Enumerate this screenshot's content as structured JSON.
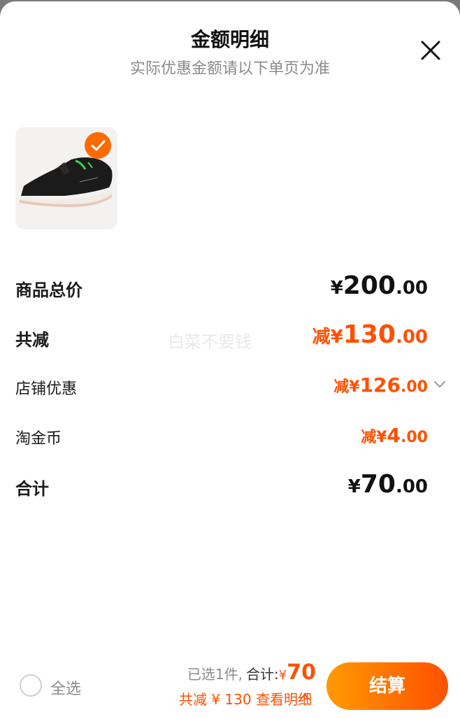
{
  "header": {
    "title": "金额明细",
    "subtitle": "实际优惠金额请以下单页为准",
    "close_icon": "close-icon"
  },
  "product": {
    "image_icon": "running-shoe-image",
    "selected": true
  },
  "summary": {
    "total_price": {
      "label": "商品总价",
      "symbol": "¥",
      "int": "200",
      "dec": ".00"
    },
    "total_discount": {
      "label": "共减",
      "prefix": "减",
      "symbol": "¥",
      "int": "130",
      "dec": ".00"
    },
    "shop_discount": {
      "label": "店铺优惠",
      "prefix": "减",
      "symbol": "¥",
      "int": "126",
      "dec": ".00",
      "icon": "chevron-down-icon"
    },
    "taojinbi": {
      "label": "淘金币",
      "prefix": "减",
      "symbol": "¥",
      "int": "4",
      "dec": ".00"
    },
    "total": {
      "label": "合计",
      "symbol": "¥",
      "int": "70",
      "dec": ".00"
    }
  },
  "watermark": "白菜不要钱",
  "footer": {
    "select_all": "全选",
    "selected_count": "已选1件,",
    "total_label": "合计:",
    "total_symbol": "¥",
    "total_value": "70",
    "discount_text": "共减 ¥ 130",
    "view_detail": "查看明细",
    "checkout": "结算"
  },
  "colors": {
    "accent": "#ff5000",
    "button_gradient_start": "#ff9a00",
    "button_gradient_end": "#ff5000"
  }
}
